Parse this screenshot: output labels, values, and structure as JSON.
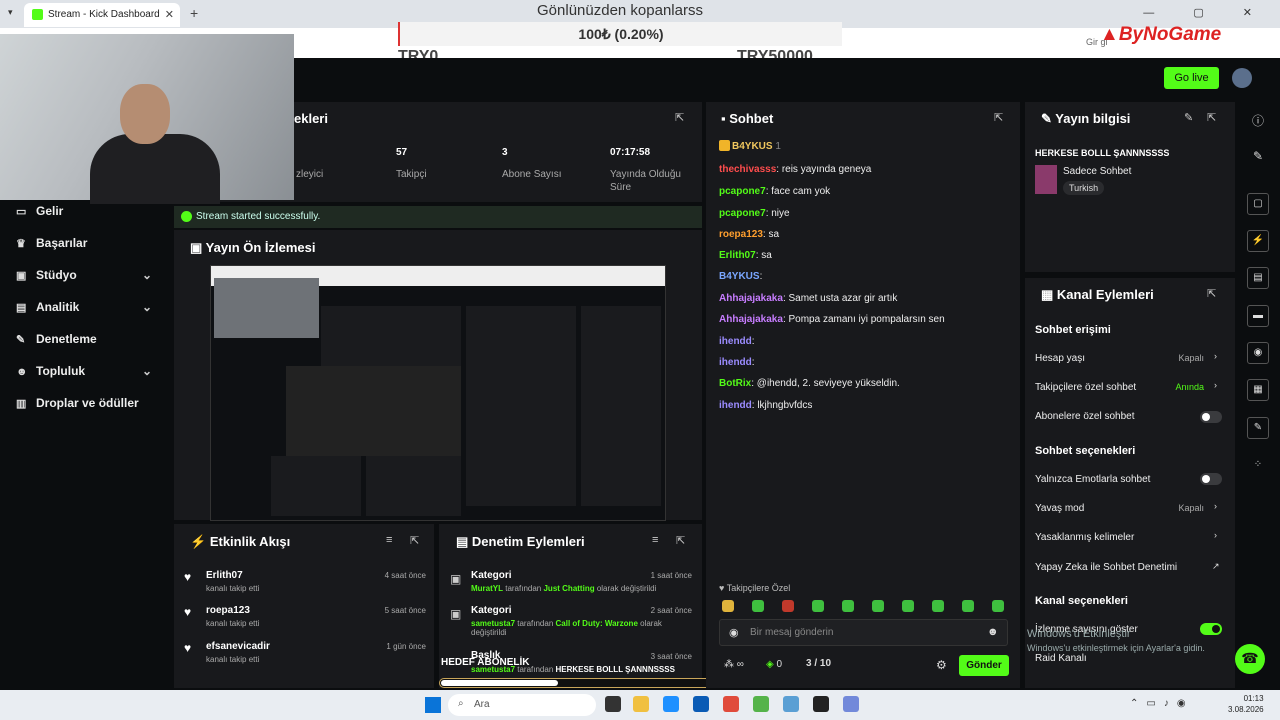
{
  "browser": {
    "tab_title": "Stream - Kick Dashboard",
    "window_controls": "— ▢ ✕"
  },
  "overlay": {
    "song_title": "Gönlünüzden kopanlarss",
    "goal_value": "100₺ (0.20%)",
    "goal_start": "TRY0",
    "goal_end": "TRY50000",
    "brand": "ByNoGame",
    "yt_hint": "Gir gi",
    "hedef_label": "HEDEF ABONELİK",
    "hedef_fraction": 0.3
  },
  "header": {
    "go_live": "Go live"
  },
  "sidebar": {
    "items": [
      {
        "label": "Gelir",
        "icon": "$"
      },
      {
        "label": "Başarılar",
        "icon": "🏆"
      },
      {
        "label": "Stüdyo",
        "icon": "▭"
      },
      {
        "label": "Analitik",
        "icon": "▤"
      },
      {
        "label": "Denetleme",
        "icon": "🔧"
      },
      {
        "label": "Topluluk",
        "icon": "👥"
      },
      {
        "label": "Droplar ve ödüller",
        "icon": "▥"
      }
    ]
  },
  "stats": {
    "title": "ekleri",
    "items": [
      {
        "value": "",
        "label": "zleyici"
      },
      {
        "value": "57",
        "label": "Takipçi"
      },
      {
        "value": "3",
        "label": "Abone Sayısı"
      },
      {
        "value": "07:17:58",
        "label": "Yayında Olduğu Süre"
      }
    ]
  },
  "toast": "Stream started successfully.",
  "preview": {
    "title": "Yayın Ön İzlemesi"
  },
  "activity": {
    "title": "Etkinlik Akışı",
    "items": [
      {
        "name": "Erlith07",
        "sub": "kanalı takip etti",
        "time": "4 saat önce"
      },
      {
        "name": "roepa123",
        "sub": "kanalı takip etti",
        "time": "5 saat önce"
      },
      {
        "name": "efsanevicadir",
        "sub": "kanalı takip etti",
        "time": "1 gün önce"
      }
    ]
  },
  "moderation": {
    "title": "Denetim Eylemleri",
    "items": [
      {
        "name": "Kategori",
        "actor": "MuratYL",
        "mid": " tarafından ",
        "target": "Just Chatting",
        "rest": " olarak değiştirildi",
        "time": "1 saat önce"
      },
      {
        "name": "Kategori",
        "actor": "sametusta7",
        "mid": " tarafından ",
        "target": "Call of Duty: Warzone",
        "rest": " olarak değiştirildi",
        "time": "2 saat önce"
      },
      {
        "name": "Başlık",
        "actor": "sametusta7",
        "mid": " tarafından ",
        "target": "HERKESE BOLLL ŞANNNSSSS",
        "rest": "",
        "time": "3 saat önce"
      }
    ]
  },
  "chat": {
    "title": "Sohbet",
    "pinned_user": "B4YKUS",
    "pinned_count": "1",
    "messages": [
      {
        "user": "thechivasss",
        "color": "#ff4d4d",
        "text": ": reis yayında geneya"
      },
      {
        "user": "pcapone7",
        "color": "#53fc18",
        "text": ": face cam yok"
      },
      {
        "user": "pcapone7",
        "color": "#53fc18",
        "text": ": niye"
      },
      {
        "user": "roepa123",
        "color": "#ff9f2e",
        "text": ": sa"
      },
      {
        "user": "Erlith07",
        "color": "#53fc18",
        "text": ": sa"
      },
      {
        "user": "B4YKUS",
        "color": "#7aa7ff",
        "text": ":"
      },
      {
        "user": "Ahhajajakaka",
        "color": "#c77dff",
        "text": ": Samet usta azar gir artık"
      },
      {
        "user": "Ahhajajakaka",
        "color": "#c77dff",
        "text": ": Pompa zamanı iyi pompalarsın sen"
      },
      {
        "user": "ihendd",
        "color": "#9b8cff",
        "text": ":"
      },
      {
        "user": "ihendd",
        "color": "#9b8cff",
        "text": ":"
      },
      {
        "user": "BotRix",
        "color": "#53fc18",
        "text": ": @ihendd, 2. seviyeye yükseldin."
      },
      {
        "user": "ihendd",
        "color": "#9b8cff",
        "text": ": lkjhngbvfdcs"
      }
    ],
    "followers_only": "Takipçilere Özel",
    "placeholder": "Bir mesaj gönderin",
    "count_left": "0",
    "count_mid": "0",
    "char_count": "3 / 10",
    "send": "Gönder"
  },
  "stream_info": {
    "title": "Yayın bilgisi",
    "stream_title": "HERKESE BOLLL ŞANNNSSSS",
    "category": "Sadece Sohbet",
    "language": "Turkish"
  },
  "channel_actions": {
    "title": "Kanal Eylemleri",
    "section_chat_access": "Sohbet erişimi",
    "account_age": "Hesap yaşı",
    "account_age_val": "Kapalı",
    "followers_chat": "Takipçilere özel sohbet",
    "followers_chat_val": "Anında",
    "subs_chat": "Abonelere özel sohbet",
    "section_chat_options": "Sohbet seçenekleri",
    "emote_only": "Yalnızca Emotlarla sohbet",
    "slow_mode": "Yavaş mod",
    "slow_mode_val": "Kapalı",
    "banned_words": "Yasaklanmış kelimeler",
    "ai_mod": "Yapay Zeka ile Sohbet Denetimi",
    "section_channel": "Kanal seçenekleri",
    "view_count": "İzlenme sayısını göster",
    "raid": "Raid Kanalı"
  },
  "watermark": {
    "line1": "Windows'u Etkinleştir",
    "line2": "Windows'u etkinleştirmek için Ayarlar'a gidin."
  },
  "taskbar": {
    "search": "Ara",
    "time": "01:13",
    "date": "3.08.2026"
  }
}
